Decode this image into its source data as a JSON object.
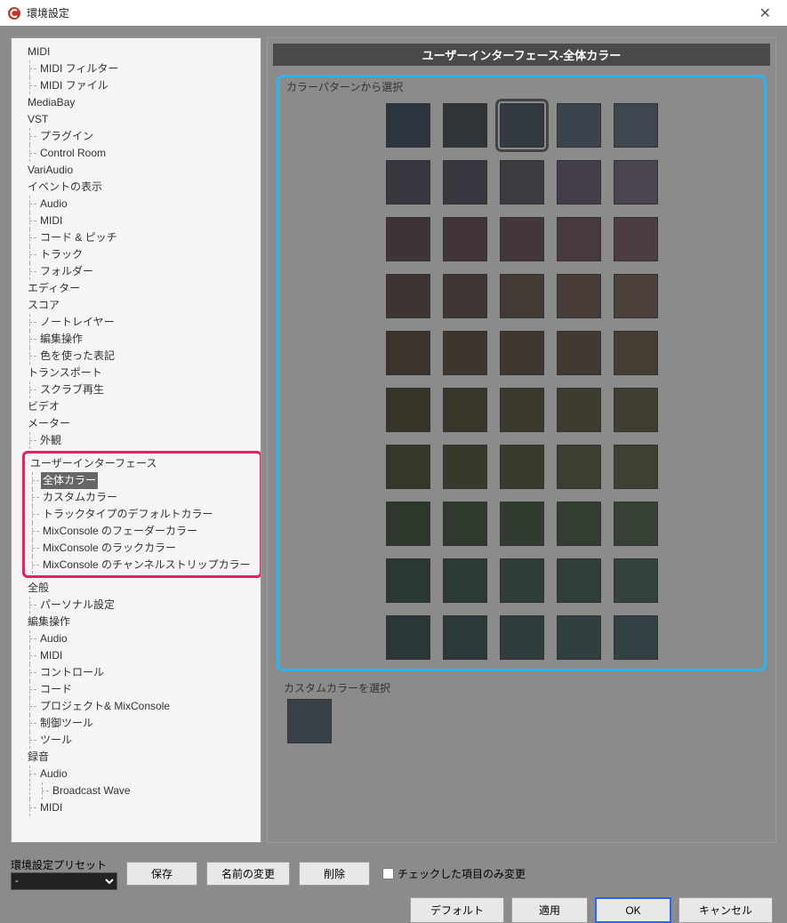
{
  "window": {
    "title": "環境設定"
  },
  "tree": {
    "midi": "MIDI",
    "midi_filter": "MIDI フィルター",
    "midi_file": "MIDI ファイル",
    "mediabay": "MediaBay",
    "vst": "VST",
    "plugin": "プラグイン",
    "control_room": "Control Room",
    "variaudio": "VariAudio",
    "event_display": "イベントの表示",
    "ev_audio": "Audio",
    "ev_midi": "MIDI",
    "ev_chord": "コード & ピッチ",
    "ev_track": "トラック",
    "ev_folder": "フォルダー",
    "editor": "エディター",
    "score": "スコア",
    "score_notelayer": "ノートレイヤー",
    "score_editop": "編集操作",
    "score_colornote": "色を使った表記",
    "transport": "トランスポート",
    "scrub": "スクラブ再生",
    "video": "ビデオ",
    "meter": "メーター",
    "meter_appearance": "外観",
    "ui": "ユーザーインターフェース",
    "ui_global": "全体カラー",
    "ui_custom": "カスタムカラー",
    "ui_tracktype": "トラックタイプのデフォルトカラー",
    "ui_mixfader": "MixConsole のフェーダーカラー",
    "ui_mixrack": "MixConsole のラックカラー",
    "ui_mixstrip": "MixConsole のチャンネルストリップカラー",
    "general": "全般",
    "personal": "パーソナル設定",
    "editop": "編集操作",
    "eo_audio": "Audio",
    "eo_midi": "MIDI",
    "eo_control": "コントロール",
    "eo_chord": "コード",
    "eo_proj": "プロジェクト& MixConsole",
    "eo_tool": "制御ツール",
    "eo_tools": "ツール",
    "record": "録音",
    "rec_audio": "Audio",
    "rec_bwave": "Broadcast Wave",
    "rec_midi": "MIDI"
  },
  "panel": {
    "header": "ユーザーインターフェース-全体カラー",
    "pattern_label": "カラーパターンから選択",
    "custom_label": "カスタムカラーを選択",
    "selected_index": 2,
    "swatches": [
      "#2d3540",
      "#2f3439",
      "#343a42",
      "#3b434d",
      "#3e4650",
      "#3a3640",
      "#3b3741",
      "#3e3a42",
      "#433e49",
      "#49444f",
      "#3e3337",
      "#403439",
      "#43373c",
      "#48393f",
      "#4d3d43",
      "#3e3532",
      "#403633",
      "#433935",
      "#473c37",
      "#4c403a",
      "#3b332c",
      "#3d352e",
      "#3f3730",
      "#423a32",
      "#453c34",
      "#373529",
      "#39372b",
      "#3b392d",
      "#3e3c2f",
      "#403e31",
      "#333829",
      "#353a2b",
      "#373c2d",
      "#3a3f2f",
      "#3c4131",
      "#2e372c",
      "#30392e",
      "#323b30",
      "#343e32",
      "#374034",
      "#2b3832",
      "#2d3a34",
      "#2f3d36",
      "#313f38",
      "#33423a",
      "#2a3738",
      "#2c393a",
      "#2e3c3d",
      "#303f40",
      "#324143"
    ],
    "custom_swatch": "#3a4149"
  },
  "preset": {
    "label": "環境設定プリセット",
    "selected": "-",
    "save": "保存",
    "rename": "名前の変更",
    "delete": "削除",
    "checkbox": "チェックした項目のみ変更"
  },
  "buttons": {
    "default": "デフォルト",
    "apply": "適用",
    "ok": "OK",
    "cancel": "キャンセル"
  }
}
